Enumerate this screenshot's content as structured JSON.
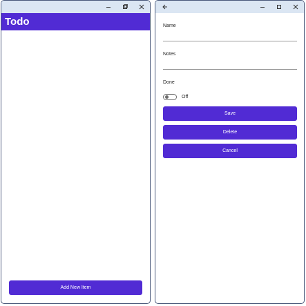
{
  "left_window": {
    "header_title": "Todo",
    "add_button_label": "Add New Item"
  },
  "right_window": {
    "form": {
      "name_label": "Name",
      "name_value": "",
      "notes_label": "Notes",
      "notes_value": "",
      "done_label": "Done",
      "done_state": "Off",
      "done_checked": false
    },
    "buttons": {
      "save": "Save",
      "delete": "Delete",
      "cancel": "Cancel"
    }
  },
  "colors": {
    "accent": "#512bd4",
    "titlebar": "#dbe6f3",
    "window_border": "#49587a"
  },
  "icons": {
    "titlebar_controls": [
      "minimize-icon",
      "maximize-icon",
      "close-icon"
    ],
    "back": "back-arrow-icon"
  }
}
